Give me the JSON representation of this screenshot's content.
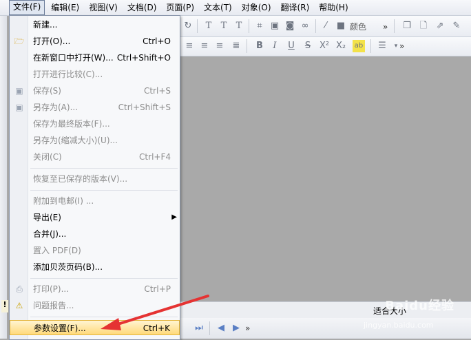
{
  "menubar": {
    "items": [
      {
        "label": "文件(F)"
      },
      {
        "label": "编辑(E)"
      },
      {
        "label": "视图(V)"
      },
      {
        "label": "文档(D)"
      },
      {
        "label": "页面(P)"
      },
      {
        "label": "文本(T)"
      },
      {
        "label": "对象(O)"
      },
      {
        "label": "翻译(R)"
      },
      {
        "label": "帮助(H)"
      }
    ]
  },
  "toolbar": {
    "color_label": "颜色",
    "more_glyph": "»"
  },
  "file_menu": {
    "items": [
      {
        "label": "新建...",
        "shortcut": "",
        "icon": ""
      },
      {
        "label": "打开(O)...",
        "shortcut": "Ctrl+O",
        "icon": "folder-open-icon"
      },
      {
        "label": "在新窗口中打开(W)...",
        "shortcut": "Ctrl+Shift+O",
        "icon": ""
      },
      {
        "label": "打开进行比较(C)...",
        "shortcut": "",
        "icon": ""
      },
      {
        "label": "保存(S)",
        "shortcut": "Ctrl+S",
        "icon": "save-icon"
      },
      {
        "label": "另存为(A)...",
        "shortcut": "Ctrl+Shift+S",
        "icon": "save-as-icon"
      },
      {
        "label": "保存为最终版本(F)...",
        "shortcut": "",
        "icon": ""
      },
      {
        "label": "另存为(缩减大小)(U)...",
        "shortcut": "",
        "icon": ""
      },
      {
        "label": "关闭(C)",
        "shortcut": "Ctrl+F4",
        "icon": ""
      },
      {
        "label": "恢复至已保存的版本(V)...",
        "shortcut": "",
        "icon": ""
      },
      {
        "label": "附加到电邮(I) ...",
        "shortcut": "",
        "icon": ""
      },
      {
        "label": "导出(E)",
        "shortcut": "",
        "icon": ""
      },
      {
        "label": "合并(J)...",
        "shortcut": "",
        "icon": ""
      },
      {
        "label": "置入 PDF(D)",
        "shortcut": "",
        "icon": ""
      },
      {
        "label": "添加贝茨页码(B)...",
        "shortcut": "",
        "icon": ""
      },
      {
        "label": "打印(P)...",
        "shortcut": "Ctrl+P",
        "icon": "printer-icon"
      },
      {
        "label": "问题报告...",
        "shortcut": "",
        "icon": "warning-icon"
      },
      {
        "label": "参数设置(F)...",
        "shortcut": "Ctrl+K",
        "icon": ""
      }
    ]
  },
  "status": {
    "zoom_text": "适合大小"
  },
  "watermark": {
    "text": "Baidu经验",
    "url": "jingyan.baidu.com"
  }
}
